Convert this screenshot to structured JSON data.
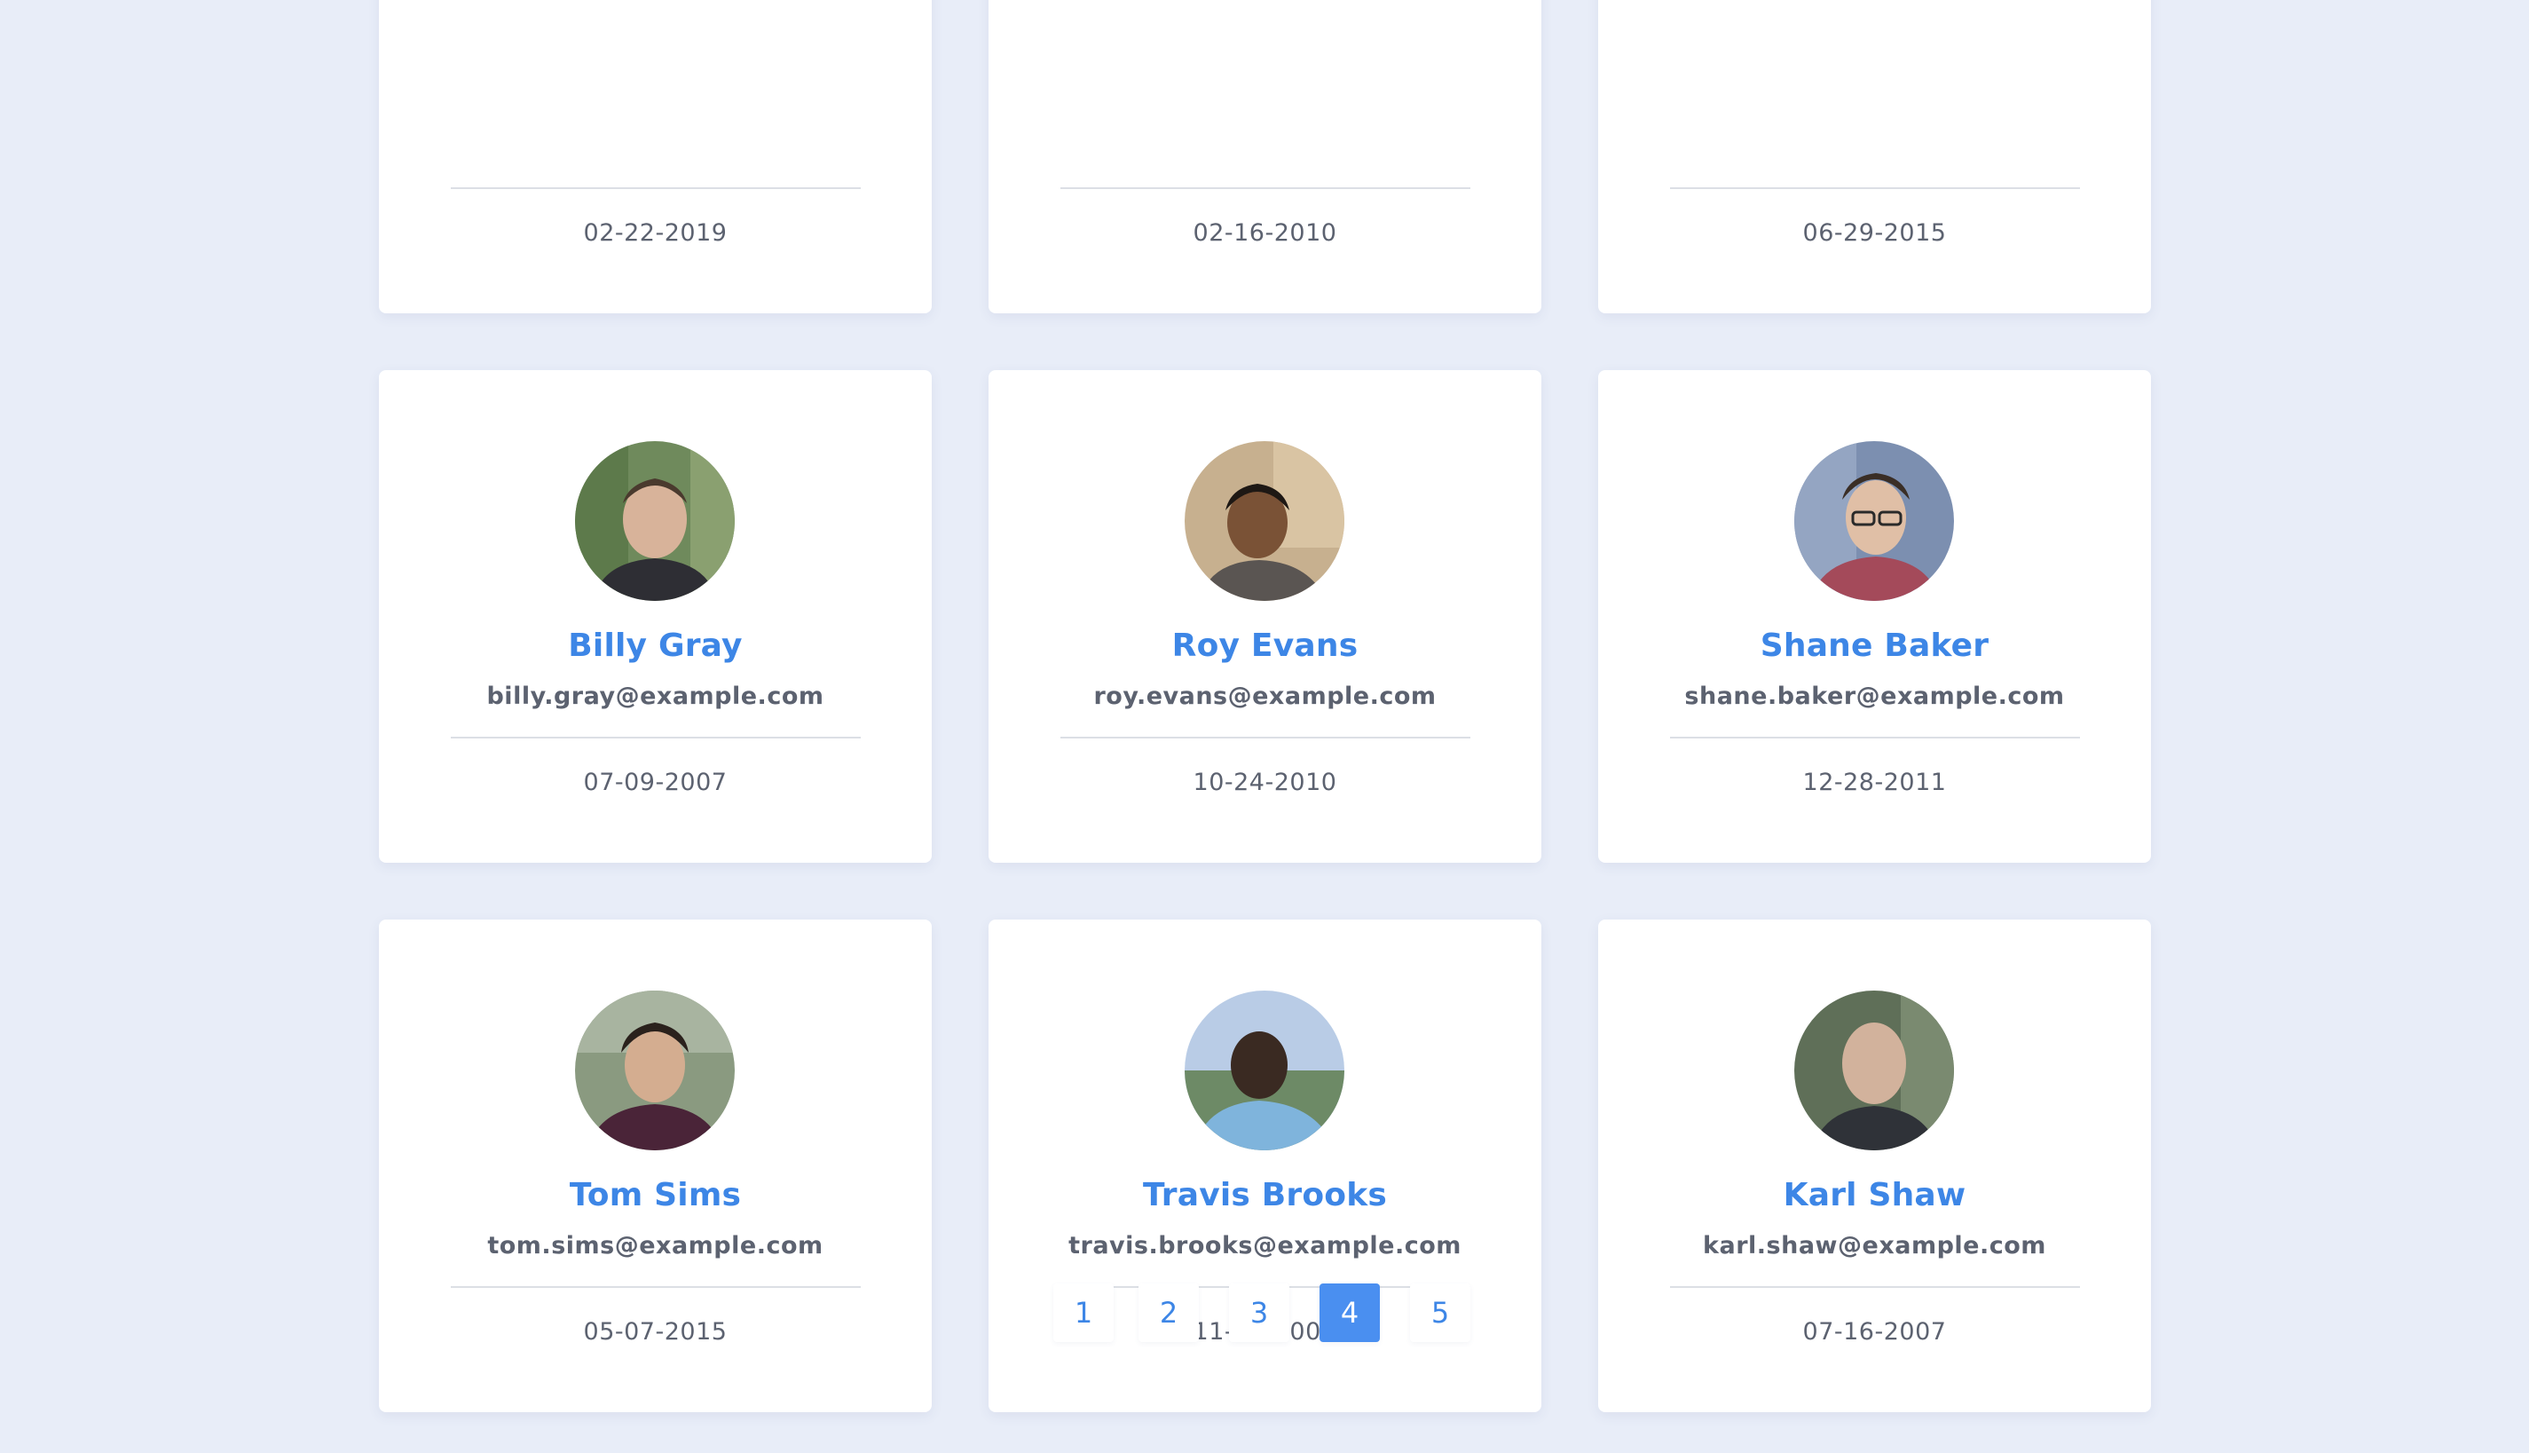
{
  "colors": {
    "background": "#e8edf8",
    "card": "#ffffff",
    "accent": "#3d86e6",
    "text_muted": "#5c6270",
    "active_page": "#4a8ff0"
  },
  "users": [
    {
      "name": "",
      "email": "",
      "date": "02-22-2019",
      "avatar": "avatar-photo"
    },
    {
      "name": "",
      "email": "",
      "date": "02-16-2010",
      "avatar": "avatar-photo"
    },
    {
      "name": "",
      "email": "",
      "date": "06-29-2015",
      "avatar": "avatar-photo"
    },
    {
      "name": "Billy Gray",
      "email": "billy.gray@example.com",
      "date": "07-09-2007",
      "avatar": "avatar-photo"
    },
    {
      "name": "Roy Evans",
      "email": "roy.evans@example.com",
      "date": "10-24-2010",
      "avatar": "avatar-photo"
    },
    {
      "name": "Shane Baker",
      "email": "shane.baker@example.com",
      "date": "12-28-2011",
      "avatar": "avatar-photo"
    },
    {
      "name": "Tom Sims",
      "email": "tom.sims@example.com",
      "date": "05-07-2015",
      "avatar": "avatar-photo"
    },
    {
      "name": "Travis Brooks",
      "email": "travis.brooks@example.com",
      "date": "11-23-2008",
      "avatar": "avatar-photo"
    },
    {
      "name": "Karl Shaw",
      "email": "karl.shaw@example.com",
      "date": "07-16-2007",
      "avatar": "avatar-photo"
    }
  ],
  "pagination": {
    "pages": [
      "1",
      "2",
      "3",
      "4",
      "5"
    ],
    "current": "4"
  }
}
